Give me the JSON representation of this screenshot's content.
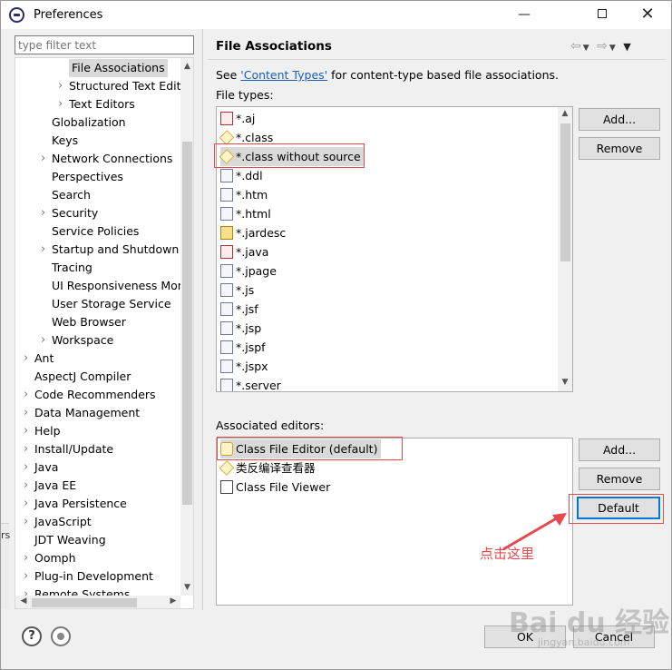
{
  "window": {
    "title": "Preferences"
  },
  "left": {
    "filter_placeholder": "type filter text",
    "tree": [
      {
        "label": "File Associations",
        "depth": 3,
        "arrow": "",
        "selected": true
      },
      {
        "label": "Structured Text Editc",
        "depth": 3,
        "arrow": "›"
      },
      {
        "label": "Text Editors",
        "depth": 3,
        "arrow": "›"
      },
      {
        "label": "Globalization",
        "depth": 2,
        "arrow": ""
      },
      {
        "label": "Keys",
        "depth": 2,
        "arrow": ""
      },
      {
        "label": "Network Connections",
        "depth": 2,
        "arrow": "›"
      },
      {
        "label": "Perspectives",
        "depth": 2,
        "arrow": ""
      },
      {
        "label": "Search",
        "depth": 2,
        "arrow": ""
      },
      {
        "label": "Security",
        "depth": 2,
        "arrow": "›"
      },
      {
        "label": "Service Policies",
        "depth": 2,
        "arrow": ""
      },
      {
        "label": "Startup and Shutdown",
        "depth": 2,
        "arrow": "›"
      },
      {
        "label": "Tracing",
        "depth": 2,
        "arrow": ""
      },
      {
        "label": "UI Responsiveness Mor",
        "depth": 2,
        "arrow": ""
      },
      {
        "label": "User Storage Service",
        "depth": 2,
        "arrow": ""
      },
      {
        "label": "Web Browser",
        "depth": 2,
        "arrow": ""
      },
      {
        "label": "Workspace",
        "depth": 2,
        "arrow": "›"
      },
      {
        "label": "Ant",
        "depth": 1,
        "arrow": "›"
      },
      {
        "label": "AspectJ Compiler",
        "depth": 1,
        "arrow": ""
      },
      {
        "label": "Code Recommenders",
        "depth": 1,
        "arrow": "›"
      },
      {
        "label": "Data Management",
        "depth": 1,
        "arrow": "›"
      },
      {
        "label": "Help",
        "depth": 1,
        "arrow": "›"
      },
      {
        "label": "Install/Update",
        "depth": 1,
        "arrow": "›"
      },
      {
        "label": "Java",
        "depth": 1,
        "arrow": "›"
      },
      {
        "label": "Java EE",
        "depth": 1,
        "arrow": "›"
      },
      {
        "label": "Java Persistence",
        "depth": 1,
        "arrow": "›"
      },
      {
        "label": "JavaScript",
        "depth": 1,
        "arrow": "›"
      },
      {
        "label": "JDT Weaving",
        "depth": 1,
        "arrow": ""
      },
      {
        "label": "Oomph",
        "depth": 1,
        "arrow": "›"
      },
      {
        "label": "Plug-in Development",
        "depth": 1,
        "arrow": "›"
      },
      {
        "label": "Remote Systems",
        "depth": 1,
        "arrow": "›"
      }
    ]
  },
  "right": {
    "title": "File Associations",
    "see_prefix": "See ",
    "see_link": "'Content Types'",
    "see_suffix": " for content-type based file associations.",
    "file_types_label": "File types:",
    "file_types": [
      {
        "label": "*.aj",
        "icon": "java"
      },
      {
        "label": "*.class",
        "icon": "class"
      },
      {
        "label": "*.class without source",
        "icon": "class",
        "selected": true
      },
      {
        "label": "*.ddl",
        "icon": "doc"
      },
      {
        "label": "*.htm",
        "icon": "doc"
      },
      {
        "label": "*.html",
        "icon": "doc"
      },
      {
        "label": "*.jardesc",
        "icon": "folder"
      },
      {
        "label": "*.java",
        "icon": "java"
      },
      {
        "label": "*.jpage",
        "icon": "doc"
      },
      {
        "label": "*.js",
        "icon": "doc"
      },
      {
        "label": "*.jsf",
        "icon": "doc"
      },
      {
        "label": "*.jsp",
        "icon": "doc"
      },
      {
        "label": "*.jspf",
        "icon": "doc"
      },
      {
        "label": "*.jspx",
        "icon": "doc"
      },
      {
        "label": "*.server",
        "icon": "doc"
      }
    ],
    "associated_editors_label": "Associated editors:",
    "associated_editors": [
      {
        "label": "Class File Editor (default)",
        "icon": "cfe",
        "selected": true
      },
      {
        "label": "类反编译查看器",
        "icon": "class"
      },
      {
        "label": "Class File Viewer",
        "icon": "viewer"
      }
    ],
    "buttons": {
      "add": "Add...",
      "remove": "Remove",
      "default": "Default"
    },
    "annotation": "点击这里"
  },
  "footer": {
    "ok": "OK",
    "cancel": "Cancel"
  },
  "watermark": {
    "text": "Bai du 经验",
    "sub": "jingyan.baidu.com"
  },
  "colors": {
    "highlight": "#e8474e",
    "link": "#1a5fb4",
    "focus": "#0078d7"
  },
  "under_text": "rs"
}
